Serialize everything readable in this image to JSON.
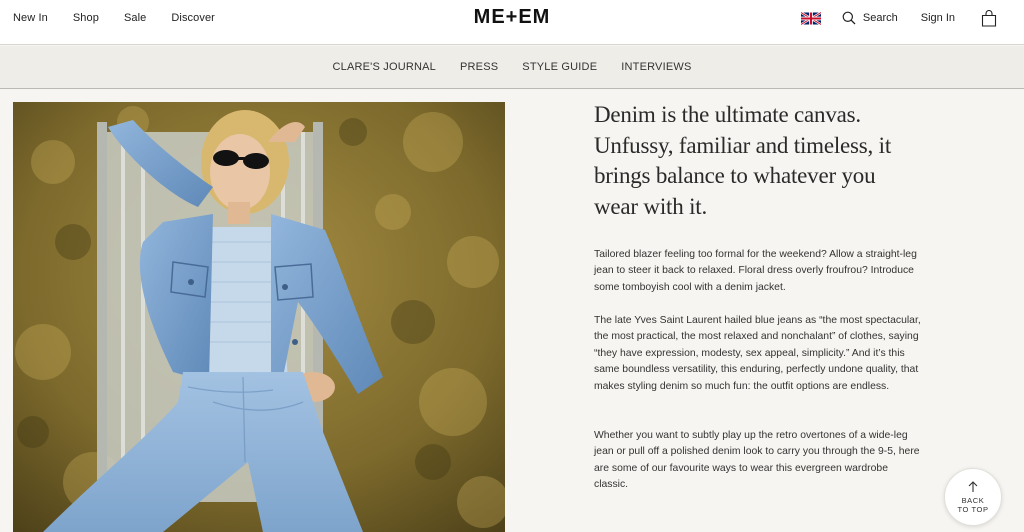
{
  "header": {
    "nav_left": [
      "New In",
      "Shop",
      "Sale",
      "Discover"
    ],
    "logo": "ME+EM",
    "search_label": "Search",
    "signin_label": "Sign In",
    "flag_icon": "uk-flag-icon",
    "bag_icon": "shopping-bag-icon",
    "search_icon": "search-icon"
  },
  "subnav": {
    "items": [
      "CLARE'S JOURNAL",
      "PRESS",
      "STYLE GUIDE",
      "INTERVIEWS"
    ]
  },
  "article": {
    "headline": "Denim is the ultimate canvas. Unfussy, familiar and timeless, it brings balance to whatever you wear with it.",
    "paragraphs": [
      "Tailored blazer feeling too formal for the weekend? Allow a straight-leg jean to steer it back to relaxed. Floral dress overly froufrou? Introduce some tomboyish cool with a denim jacket.",
      "The late Yves Saint Laurent hailed blue jeans as “the most spectacular, the most practical, the most relaxed and nonchalant” of clothes, saying “they have expression, modesty, sex appeal, simplicity.” And it’s this same boundless versatility, this enduring, perfectly undone quality, that makes styling denim so much fun: the outfit options are endless.",
      "Whether you want to subtly play up the retro overtones of a wide-leg jean or pull off a polished denim look to carry you through the 9-5, here are some of our favourite ways to wear this evergreen wardrobe classic."
    ]
  },
  "back_to_top": {
    "line1": "BACK",
    "line2": "TO TOP"
  },
  "colors": {
    "page_bg": "#f7f5f1",
    "subnav_bg": "#efede8",
    "denim": "#7aa3cf",
    "grass": "#8a7430"
  }
}
